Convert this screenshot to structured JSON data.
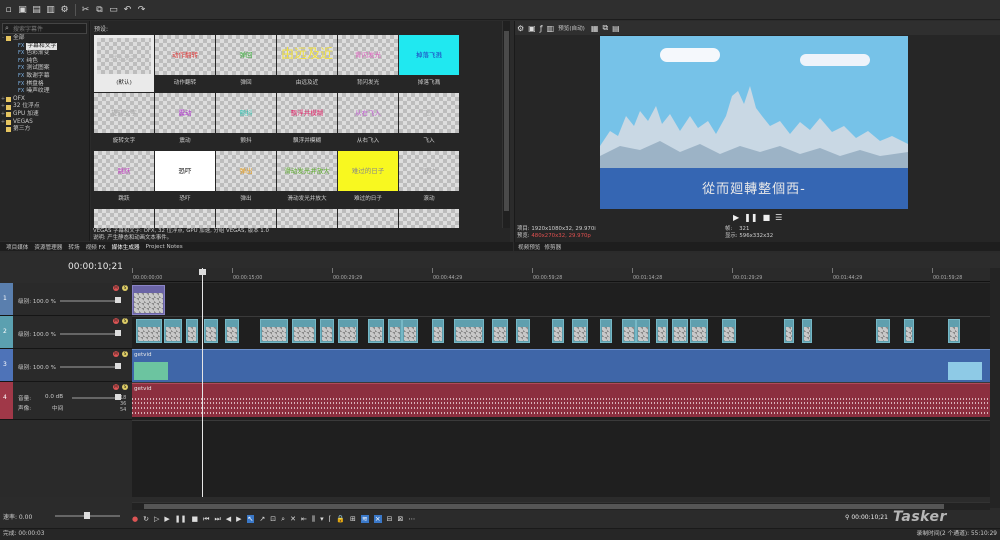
{
  "toolbar": {
    "buttons": [
      "new-icon",
      "open-icon",
      "save-icon",
      "render-icon",
      "properties-icon",
      "cut-icon",
      "copy-icon",
      "paste-icon",
      "undo-icon",
      "redo-icon"
    ]
  },
  "tree": {
    "search_placeholder": "搜索字幕件",
    "items": [
      {
        "exp": "-",
        "type": "folder",
        "label": "全部"
      },
      {
        "exp": "",
        "type": "fx",
        "label": "字幕和文字",
        "selected": true
      },
      {
        "exp": "",
        "type": "fx",
        "label": "色彩渐变"
      },
      {
        "exp": "",
        "type": "fx",
        "label": "纯色"
      },
      {
        "exp": "",
        "type": "fx",
        "label": "测试图案"
      },
      {
        "exp": "",
        "type": "fx",
        "label": "致谢字幕"
      },
      {
        "exp": "",
        "type": "fx",
        "label": "棋盘格"
      },
      {
        "exp": "",
        "type": "fx",
        "label": "噪声纹理"
      },
      {
        "exp": "+",
        "type": "folder",
        "label": "OFX"
      },
      {
        "exp": "+",
        "type": "folder",
        "label": "32 位浮点"
      },
      {
        "exp": "+",
        "type": "folder",
        "label": "GPU 加速"
      },
      {
        "exp": "+",
        "type": "folder",
        "label": "VEGAS"
      },
      {
        "exp": "",
        "type": "folder",
        "label": "第三方"
      }
    ]
  },
  "presets": {
    "title": "预设:",
    "items": [
      {
        "caption": "(默认)",
        "thumb": "默认文字",
        "color": "#bbbbbb",
        "bg": ""
      },
      {
        "caption": "动作翻转",
        "thumb": "动作翻转",
        "color": "#e04040",
        "bg": ""
      },
      {
        "caption": "弹回",
        "thumb": "弹回",
        "color": "#40b040",
        "bg": ""
      },
      {
        "caption": "由远及近",
        "thumb": "由远及近",
        "color": "#f0e040",
        "bg": ""
      },
      {
        "caption": "背闪发光",
        "thumb": "背闪发光",
        "color": "#e060c0",
        "bg": ""
      },
      {
        "caption": "掉落飞溅",
        "thumb": "掉落飞溅",
        "color": "#2040c0",
        "bg": "#20e8f0"
      },
      {
        "caption": "旋转文字",
        "thumb": "旋转文字",
        "color": "#aaaaaa",
        "bg": ""
      },
      {
        "caption": "震动",
        "thumb": "震动",
        "color": "#b030d0",
        "bg": ""
      },
      {
        "caption": "颤抖",
        "thumb": "颤抖",
        "color": "#30c0b0",
        "bg": ""
      },
      {
        "caption": "飘浮并模糊",
        "thumb": "飘浮并模糊",
        "color": "#e03070",
        "bg": ""
      },
      {
        "caption": "从右飞入",
        "thumb": "从右飞入",
        "color": "#c060d0",
        "bg": ""
      },
      {
        "caption": "飞入",
        "thumb": "飞入",
        "color": "#aaaaaa",
        "bg": ""
      },
      {
        "caption": "跳跃",
        "thumb": "跳跃",
        "color": "#c040c0",
        "bg": ""
      },
      {
        "caption": "恐吓",
        "thumb": "恐吓",
        "color": "#111111",
        "bg": "#ffffff"
      },
      {
        "caption": "弹出",
        "thumb": "弹出",
        "color": "#e8a020",
        "bg": ""
      },
      {
        "caption": "滑动发光并放大",
        "thumb": "滑动发光并放大",
        "color": "#60b030",
        "bg": ""
      },
      {
        "caption": "难过的日子",
        "thumb": "难过的日子",
        "color": "#888888",
        "bg": "#f8f820"
      },
      {
        "caption": "滚动",
        "thumb": "滚动",
        "color": "#aaaaaa",
        "bg": ""
      },
      {
        "caption": "",
        "thumb": "",
        "color": "#e04040",
        "bg": ""
      },
      {
        "caption": "",
        "thumb": "",
        "color": "#aaaaaa",
        "bg": ""
      },
      {
        "caption": "",
        "thumb": "",
        "color": "#aaaaaa",
        "bg": ""
      },
      {
        "caption": "",
        "thumb": "",
        "color": "#3060d0",
        "bg": ""
      },
      {
        "caption": "",
        "thumb": "",
        "color": "#e040c0",
        "bg": ""
      },
      {
        "caption": "",
        "thumb": "",
        "color": "#aaaaaa",
        "bg": ""
      }
    ],
    "info_line1": "VEGAS 字幕和文字: OFX, 32 位浮点, GPU 加速, 分组 VEGAS, 版本 1.0",
    "info_line2": "说明: 产生静态和动画文本事件。"
  },
  "left_tabs": [
    "项目媒体",
    "资源管理器",
    "转场",
    "视频 FX",
    "媒体生成器",
    "Project Notes"
  ],
  "preview": {
    "toolbar_labels": [
      "预览(自动)"
    ],
    "subtitle": "從而廻轉整個西-",
    "project_label": "项目:",
    "project_value": "1920x1080x32, 29.970i",
    "preview_label": "预览:",
    "preview_value": "480x270x32, 29.970p",
    "frame_label": "帧:",
    "frame_value": "321",
    "display_label": "显示:",
    "display_value": "596x332x32",
    "tabs": [
      "视频预览",
      "修剪器"
    ]
  },
  "timeline": {
    "timecode": "00:00:10;21",
    "ruler": [
      "00:00:00;00",
      "00:00:15;00",
      "00:00:29;29",
      "00:00:44;29",
      "00:00:59;28",
      "00:01:14;28",
      "00:01:29;29",
      "00:01:44;29",
      "00:01:59;28"
    ],
    "tracks": [
      {
        "num": "1",
        "label": "级别: 100.0 %",
        "color": "#5a7fae"
      },
      {
        "num": "2",
        "label": "级别: 100.0 %",
        "color": "#5ba0b0"
      },
      {
        "num": "3",
        "label": "级别: 100.0 %",
        "color": "#4e73b8"
      },
      {
        "num": "4",
        "label_vol": "音量:",
        "vol": "0.0 dB",
        "label_pan": "声像:",
        "pan": "中间",
        "color": "#a03848"
      }
    ],
    "video_clip_name": "getvid",
    "audio_clip_name": "getvid",
    "audio_scale": [
      "18",
      "36",
      "54"
    ]
  },
  "bottom": {
    "rate_label": "速率: 0.00",
    "time_right": "00:00:10;21",
    "status_left": "完成: 00:00:03",
    "status_right": "录制时间(2 个通道): 55:10:29",
    "watermark": "Tasker"
  }
}
